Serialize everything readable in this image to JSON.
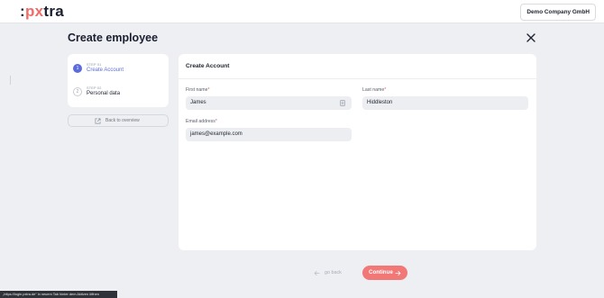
{
  "header": {
    "logo_text": ":pxtra",
    "company_button": "Demo Company GmbH"
  },
  "page": {
    "title": "Create employee"
  },
  "steps": [
    {
      "step_label": "STEP 01",
      "title": "Create Account",
      "number": "1",
      "state": "active"
    },
    {
      "step_label": "STEP 02",
      "title": "Personal data",
      "number": "2",
      "state": "inactive"
    }
  ],
  "sidebar": {
    "back_to_overview": "Back to overview"
  },
  "form": {
    "title": "Create Account",
    "first_name": {
      "label": "First name",
      "required_mark": "*",
      "value": "James"
    },
    "last_name": {
      "label": "Last name",
      "required_mark": "*",
      "value": "Hiddleston"
    },
    "email": {
      "label": "Email address",
      "required_mark": "*",
      "value": "james@example.com"
    }
  },
  "footer": {
    "back_label": "go back",
    "continue_label": "Continue"
  },
  "status_bar": {
    "text": "„https://login.pxtra.de“ in neuem Tab hinter dem Aktiven öffnen"
  },
  "colors": {
    "accent": "#5b6ddc",
    "primary_button": "#f27878",
    "background": "#eeeff3"
  }
}
